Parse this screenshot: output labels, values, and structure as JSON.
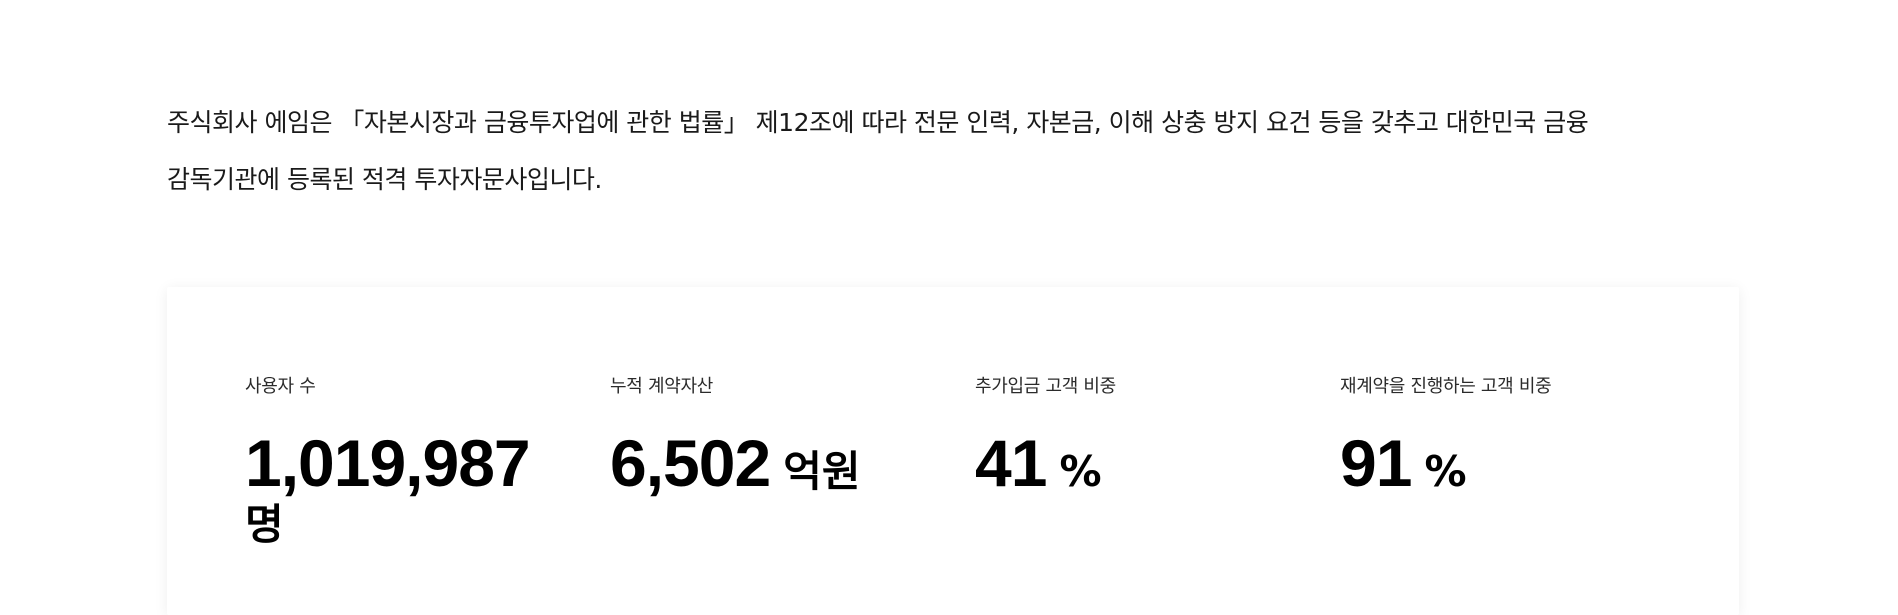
{
  "intro": {
    "line1": "주식회사 에임은 「자본시장과 금융투자업에 관한 법률」 제12조에 따라 전문 인력, 자본금, 이해 상충 방지 요건 등을 갖추고 대한민국 금융",
    "line2": "감독기관에 등록된 적격 투자자문사입니다."
  },
  "stats": [
    {
      "label": "사용자 수",
      "value": "1,019,987",
      "unit": "명"
    },
    {
      "label": "누적 계약자산",
      "value": "6,502",
      "unit": "억원"
    },
    {
      "label": "추가입금 고객 비중",
      "value": "41",
      "unit": "%"
    },
    {
      "label": "재계약을 진행하는 고객 비중",
      "value": "91",
      "unit": "%"
    }
  ]
}
